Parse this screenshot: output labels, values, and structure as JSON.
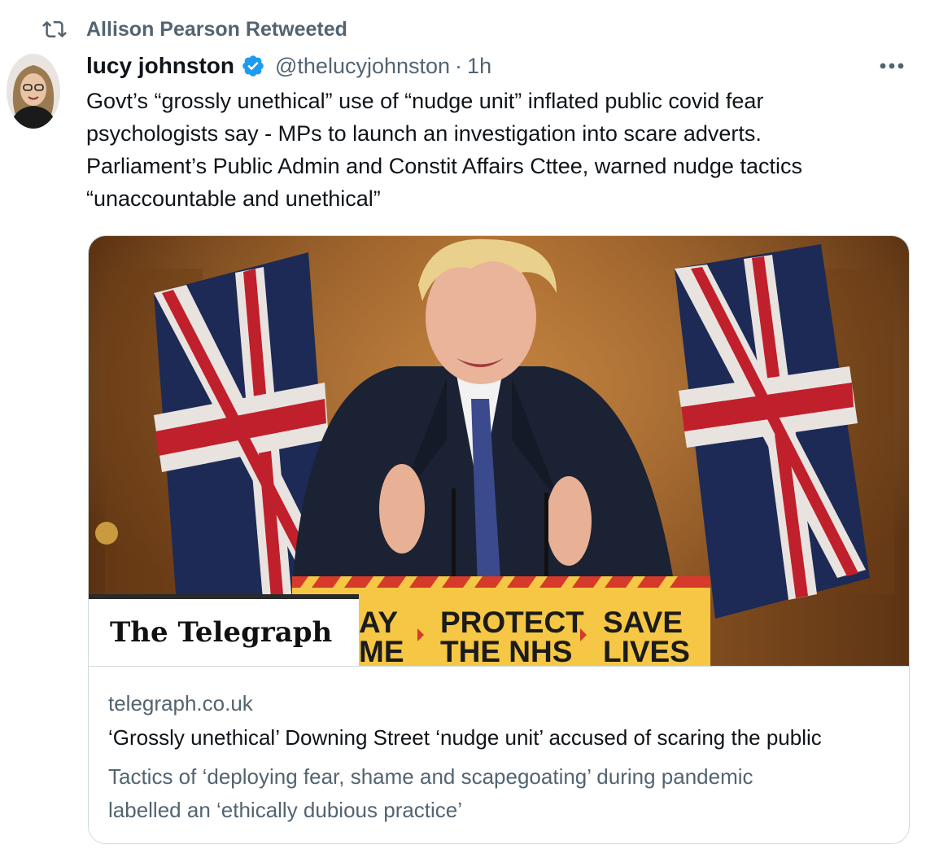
{
  "retweet": {
    "label": "Allison Pearson Retweeted",
    "icon": "retweet-icon"
  },
  "author": {
    "display_name": "lucy johnston",
    "handle": "@thelucyjohnston",
    "separator": "·",
    "time": "1h",
    "verified_color": "#1d9bf0"
  },
  "tweet": {
    "lines": [
      "Govt’s “grossly unethical” use of  “nudge unit” inflated public covid fear",
      "psychologists say - MPs to launch an investigation into scare adverts.",
      "Parliament’s Public Admin and Constit Affairs Cttee, warned  nudge tactics",
      "“unaccountable and unethical”"
    ]
  },
  "card": {
    "logo_text": "The Telegraph",
    "banner": {
      "partial_left_top": "AY",
      "partial_left_bottom": "ME",
      "protect_top": "PROTECT",
      "protect_bottom": "THE NHS",
      "save_top": "SAVE",
      "save_bottom": "LIVES"
    },
    "domain": "telegraph.co.uk",
    "title": "‘Grossly unethical’ Downing Street ‘nudge unit’ accused of scaring the public",
    "description_lines": [
      "Tactics of ‘deploying fear, shame and scapegoating’ during pandemic",
      "labelled an ‘ethically dubious practice’"
    ]
  },
  "colors": {
    "secondary_text": "#536471",
    "border": "#cfd9de",
    "banner_yellow": "#f6c744",
    "banner_red": "#d63a2b"
  }
}
